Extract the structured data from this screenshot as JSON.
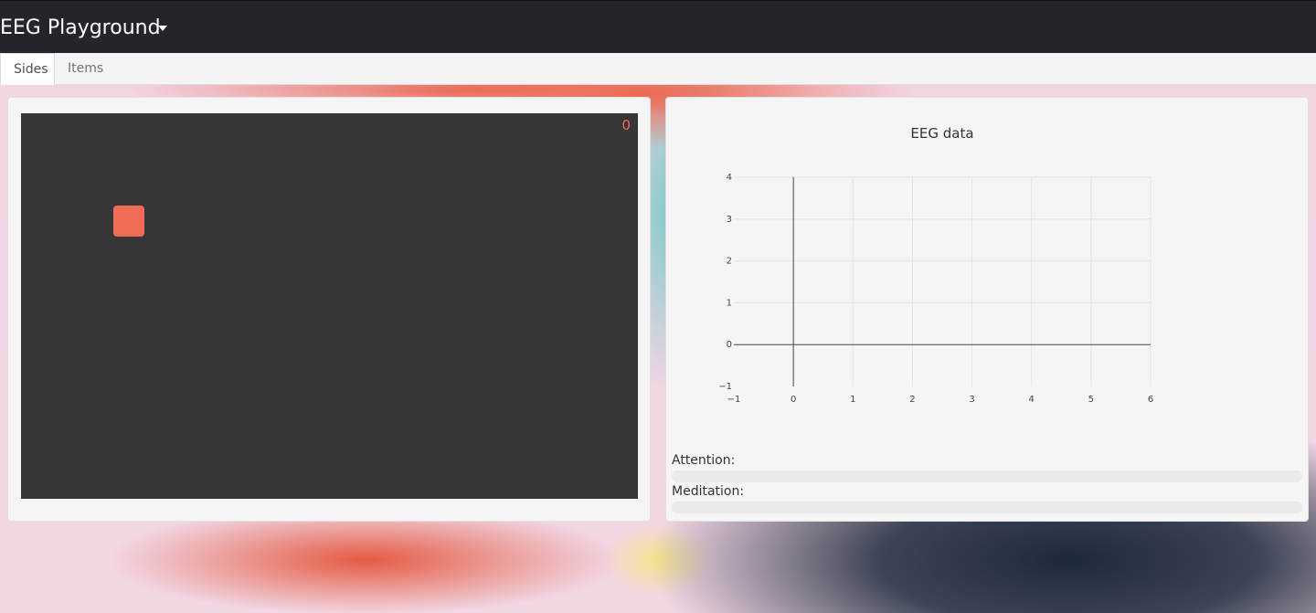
{
  "app": {
    "title": "EEG Playground"
  },
  "tabs": [
    {
      "label": "Sides",
      "active": true
    },
    {
      "label": "Items",
      "active": false
    }
  ],
  "game": {
    "score": "0",
    "block_color": "#ef6c56"
  },
  "chart_data": {
    "type": "line",
    "title": "EEG data",
    "xlabel": "",
    "ylabel": "",
    "xlim": [
      -1,
      6
    ],
    "ylim": [
      -1,
      4
    ],
    "xticks": [
      "−1",
      "0",
      "1",
      "2",
      "3",
      "4",
      "5",
      "6"
    ],
    "yticks": [
      "−1",
      "0",
      "1",
      "2",
      "3",
      "4"
    ],
    "grid": true,
    "series": []
  },
  "meters": {
    "attention": {
      "label": "Attention:",
      "value": 0
    },
    "meditation": {
      "label": "Meditation:",
      "value": 0
    }
  }
}
